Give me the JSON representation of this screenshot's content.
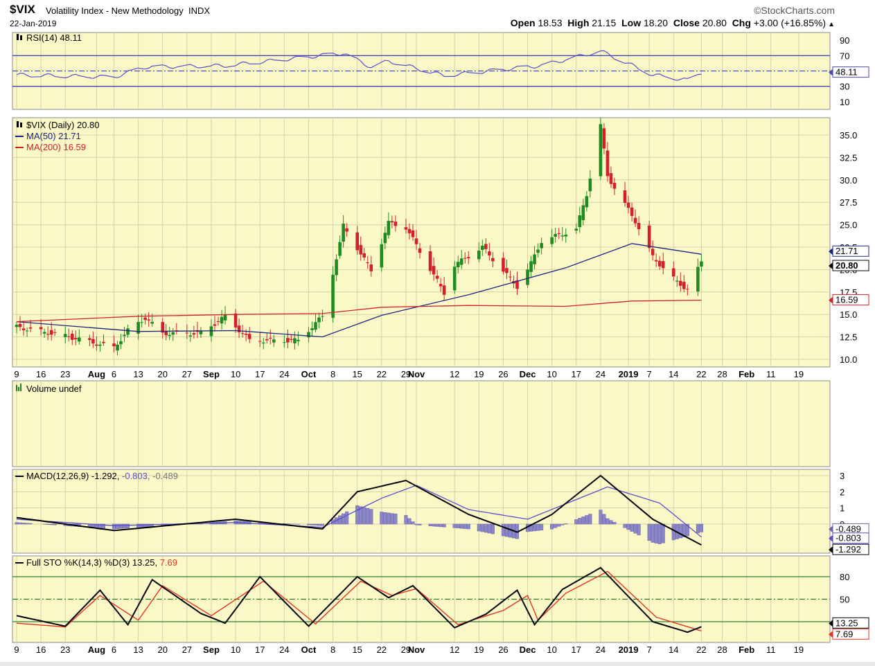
{
  "header": {
    "ticker": "$VIX",
    "name": "Volatility Index - New Methodology",
    "exchange": "INDX",
    "brand": "©StockCharts.com",
    "date": "22-Jan-2019",
    "open_label": "Open",
    "open": "18.53",
    "high_label": "High",
    "high": "21.15",
    "low_label": "Low",
    "low": "18.20",
    "close_label": "Close",
    "close": "20.80",
    "chg_label": "Chg",
    "chg": "+3.00 (+16.85%)"
  },
  "colors": {
    "panel_bg": "#fbf8c8",
    "up": "#1e8c1e",
    "down": "#d0222c",
    "ma50": "#1a237e",
    "ma200": "#d0222c",
    "rsi": "#5a4fc8",
    "macd_signal": "#5a4fc8",
    "hist": "#8b86c8",
    "sto_d": "#e53222"
  },
  "x_axis": {
    "labels": [
      "9",
      "16",
      "23",
      "Aug",
      "6",
      "13",
      "20",
      "27",
      "Sep",
      "10",
      "17",
      "24",
      "Oct",
      "8",
      "15",
      "22",
      "29",
      "Nov",
      "12",
      "19",
      "26",
      "Dec",
      "10",
      "17",
      "24",
      "2019",
      "7",
      "14",
      "22",
      "28",
      "Feb",
      "11",
      "19"
    ],
    "bold": [
      "Aug",
      "Sep",
      "Oct",
      "Nov",
      "Dec",
      "2019",
      "Feb"
    ]
  },
  "rsi": {
    "legend": "RSI(14) 48.11",
    "value_badge": "48.11",
    "ticks": [
      "90",
      "70",
      "30",
      "10"
    ]
  },
  "price": {
    "legend_main": "$VIX (Daily) 20.80",
    "legend_ma50": "MA(50) 21.71",
    "legend_ma200": "MA(200) 16.59",
    "ticks": [
      "35.0",
      "32.5",
      "30.0",
      "27.5",
      "25.0",
      "22.5",
      "20.0",
      "17.5",
      "15.0",
      "12.5",
      "10.0"
    ],
    "badge_ma50": "21.71",
    "badge_close": "20.80",
    "badge_ma200": "16.59"
  },
  "volume": {
    "legend": "Volume undef"
  },
  "macd": {
    "legend_name": "MACD(12,26,9)",
    "legend_v1": "-1.292,",
    "legend_v2": "-0.803,",
    "legend_v3": "-0.489",
    "ticks": [
      "3",
      "2",
      "1",
      "0"
    ],
    "badge1": "-0.489",
    "badge2": "-0.803",
    "badge3": "-1.292"
  },
  "sto": {
    "legend_name": "Full STO %K(14,3) %D(3)",
    "legend_k": "13.25,",
    "legend_d": "7.69",
    "ticks": [
      "80",
      "50",
      "20"
    ],
    "badge_k": "13.25",
    "badge_d": "7.69"
  },
  "chart_data": {
    "type": "line",
    "title": "$VIX Volatility Index - New Methodology INDX",
    "x_range": [
      "2018-07-09",
      "2019-01-22"
    ],
    "series": [
      {
        "name": "$VIX (Daily) close",
        "points": [
          [
            "2018-07-09",
            13.6
          ],
          [
            "2018-07-23",
            12.6
          ],
          [
            "2018-08-06",
            11.3
          ],
          [
            "2018-08-10",
            13.2
          ],
          [
            "2018-08-15",
            14.6
          ],
          [
            "2018-08-20",
            12.9
          ],
          [
            "2018-08-31",
            12.9
          ],
          [
            "2018-09-07",
            14.8
          ],
          [
            "2018-09-14",
            12.1
          ],
          [
            "2018-09-28",
            12.1
          ],
          [
            "2018-10-05",
            14.8
          ],
          [
            "2018-10-10",
            22.9
          ],
          [
            "2018-10-11",
            24.9
          ],
          [
            "2018-10-19",
            19.9
          ],
          [
            "2018-10-24",
            25.2
          ],
          [
            "2018-10-29",
            24.7
          ],
          [
            "2018-11-09",
            17.4
          ],
          [
            "2018-11-12",
            20.5
          ],
          [
            "2018-11-20",
            22.5
          ],
          [
            "2018-11-30",
            18.1
          ],
          [
            "2018-12-04",
            20.7
          ],
          [
            "2018-12-07",
            23.2
          ],
          [
            "2018-12-17",
            24.5
          ],
          [
            "2018-12-20",
            28.4
          ],
          [
            "2018-12-24",
            36.1
          ],
          [
            "2018-12-26",
            30.4
          ],
          [
            "2019-01-03",
            25.4
          ],
          [
            "2019-01-08",
            21.4
          ],
          [
            "2019-01-15",
            18.6
          ],
          [
            "2019-01-18",
            17.8
          ],
          [
            "2019-01-22",
            20.8
          ]
        ]
      },
      {
        "name": "MA(50)",
        "points": [
          [
            "2018-07-09",
            14.2
          ],
          [
            "2018-08-13",
            13.1
          ],
          [
            "2018-09-10",
            13.2
          ],
          [
            "2018-10-05",
            12.5
          ],
          [
            "2018-10-22",
            14.9
          ],
          [
            "2018-11-16",
            17.2
          ],
          [
            "2018-12-14",
            20.2
          ],
          [
            "2019-01-02",
            22.9
          ],
          [
            "2019-01-22",
            21.71
          ]
        ]
      },
      {
        "name": "MA(200)",
        "points": [
          [
            "2018-07-09",
            14.2
          ],
          [
            "2018-08-13",
            14.8
          ],
          [
            "2018-09-10",
            15.0
          ],
          [
            "2018-10-05",
            15.1
          ],
          [
            "2018-10-22",
            15.8
          ],
          [
            "2018-11-16",
            16.0
          ],
          [
            "2018-12-14",
            15.9
          ],
          [
            "2019-01-02",
            16.5
          ],
          [
            "2019-01-22",
            16.59
          ]
        ]
      },
      {
        "name": "RSI(14)",
        "points": [
          [
            "2018-07-09",
            45
          ],
          [
            "2018-08-06",
            42
          ],
          [
            "2018-08-15",
            55
          ],
          [
            "2018-09-07",
            57
          ],
          [
            "2018-10-11",
            73
          ],
          [
            "2018-10-19",
            55
          ],
          [
            "2018-10-24",
            63
          ],
          [
            "2018-11-09",
            44
          ],
          [
            "2018-12-07",
            57
          ],
          [
            "2018-12-24",
            76
          ],
          [
            "2019-01-08",
            45
          ],
          [
            "2019-01-18",
            38
          ],
          [
            "2019-01-22",
            48.11
          ]
        ]
      },
      {
        "name": "MACD",
        "points": [
          [
            "2018-07-09",
            0.4
          ],
          [
            "2018-08-06",
            -0.4
          ],
          [
            "2018-09-10",
            0.3
          ],
          [
            "2018-10-05",
            -0.3
          ],
          [
            "2018-10-15",
            2.0
          ],
          [
            "2018-10-29",
            2.7
          ],
          [
            "2018-11-16",
            0.6
          ],
          [
            "2018-11-30",
            -0.5
          ],
          [
            "2018-12-10",
            0.6
          ],
          [
            "2018-12-24",
            3.0
          ],
          [
            "2019-01-08",
            0.3
          ],
          [
            "2019-01-22",
            -1.292
          ]
        ]
      },
      {
        "name": "Signal",
        "points": [
          [
            "2018-07-09",
            0.3
          ],
          [
            "2018-08-06",
            -0.1
          ],
          [
            "2018-09-10",
            0.1
          ],
          [
            "2018-10-05",
            -0.2
          ],
          [
            "2018-10-22",
            1.6
          ],
          [
            "2018-11-01",
            2.4
          ],
          [
            "2018-11-16",
            0.9
          ],
          [
            "2018-12-03",
            0.3
          ],
          [
            "2018-12-26",
            2.3
          ],
          [
            "2019-01-10",
            1.3
          ],
          [
            "2019-01-22",
            -0.803
          ]
        ]
      },
      {
        "name": "%K",
        "points": [
          [
            "2018-07-09",
            28
          ],
          [
            "2018-07-23",
            14
          ],
          [
            "2018-08-02",
            62
          ],
          [
            "2018-08-10",
            16
          ],
          [
            "2018-08-17",
            76
          ],
          [
            "2018-08-31",
            31
          ],
          [
            "2018-09-07",
            18
          ],
          [
            "2018-09-17",
            80
          ],
          [
            "2018-10-01",
            14
          ],
          [
            "2018-10-05",
            33
          ],
          [
            "2018-10-15",
            80
          ],
          [
            "2018-10-24",
            52
          ],
          [
            "2018-10-31",
            68
          ],
          [
            "2018-11-12",
            12
          ],
          [
            "2018-11-21",
            30
          ],
          [
            "2018-11-30",
            62
          ],
          [
            "2018-12-05",
            16
          ],
          [
            "2018-12-13",
            63
          ],
          [
            "2018-12-24",
            92
          ],
          [
            "2019-01-08",
            20
          ],
          [
            "2019-01-18",
            6
          ],
          [
            "2019-01-22",
            13.25
          ]
        ]
      },
      {
        "name": "%D",
        "points": [
          [
            "2018-07-09",
            18
          ],
          [
            "2018-07-23",
            13
          ],
          [
            "2018-08-02",
            55
          ],
          [
            "2018-08-13",
            22
          ],
          [
            "2018-08-20",
            68
          ],
          [
            "2018-09-03",
            28
          ],
          [
            "2018-09-18",
            74
          ],
          [
            "2018-10-03",
            17
          ],
          [
            "2018-10-16",
            74
          ],
          [
            "2018-10-25",
            55
          ],
          [
            "2018-11-01",
            64
          ],
          [
            "2018-11-13",
            16
          ],
          [
            "2018-11-26",
            35
          ],
          [
            "2018-12-03",
            55
          ],
          [
            "2018-12-06",
            22
          ],
          [
            "2018-12-14",
            58
          ],
          [
            "2018-12-26",
            87
          ],
          [
            "2019-01-09",
            26
          ],
          [
            "2019-01-22",
            7.69
          ]
        ]
      }
    ],
    "axes": {
      "price_ylim": [
        10,
        36
      ],
      "rsi_ylim": [
        0,
        100
      ],
      "macd_ylim": [
        -1.5,
        3.2
      ],
      "sto_ylim": [
        0,
        100
      ]
    },
    "grid": true
  }
}
